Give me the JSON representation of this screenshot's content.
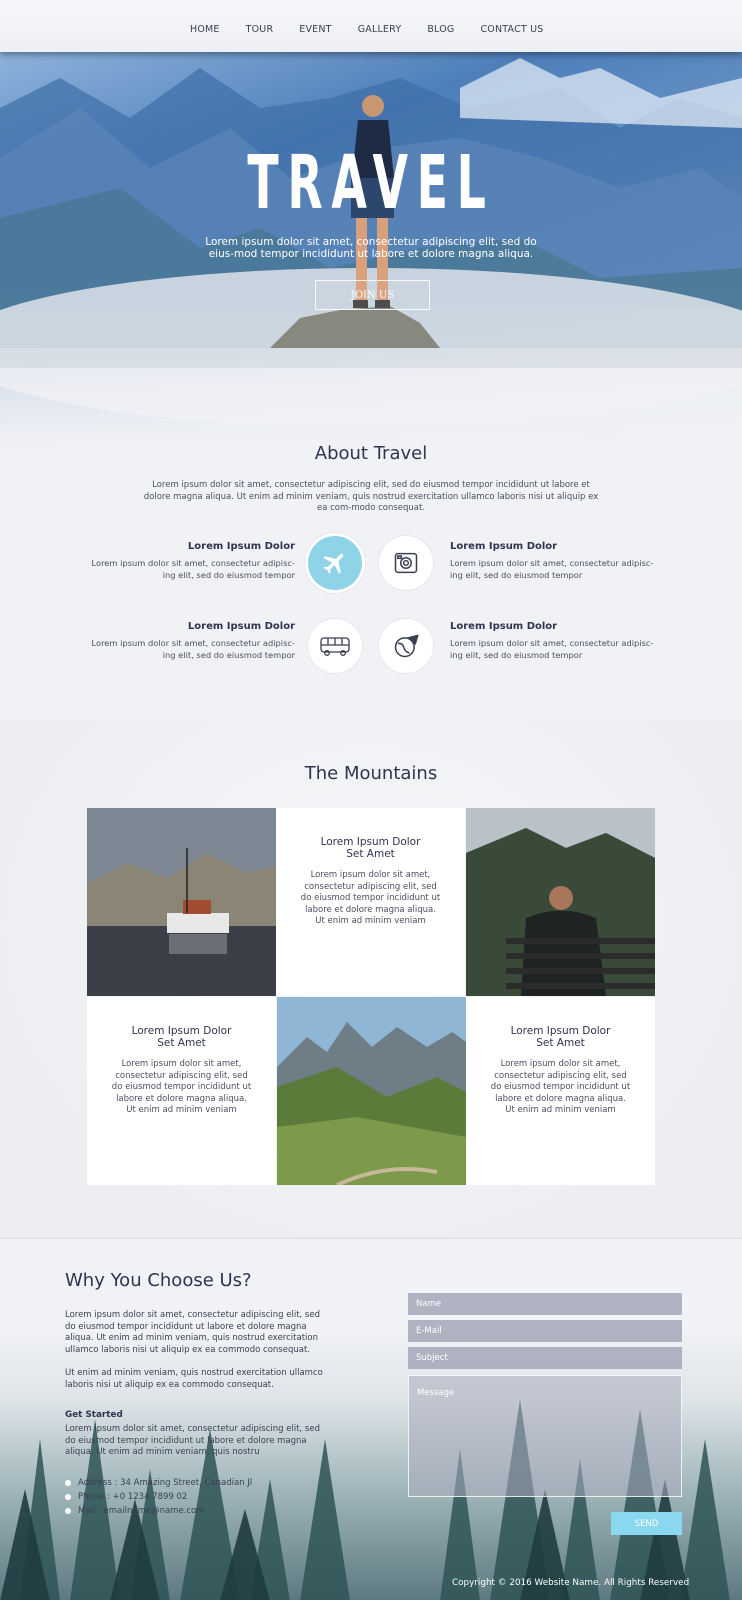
{
  "nav": {
    "items": [
      "HOME",
      "TOUR",
      "EVENT",
      "GALLERY",
      "BLOG",
      "CONTACT US"
    ]
  },
  "hero": {
    "title": "TRAVEL",
    "text": "Lorem ipsum dolor sit amet, consectetur adipiscing elit, sed do eius-mod tempor incididunt ut labore et dolore magna aliqua.",
    "button": "JOIN US"
  },
  "about": {
    "title": "About Travel",
    "text": "Lorem ipsum dolor sit amet, consectetur adipiscing elit, sed do eiusmod tempor incididunt ut labore et dolore magna aliqua. Ut enim ad minim veniam, quis nostrud exercitation ullamco laboris nisi ut aliquip ex ea com-modo consequat.",
    "features": [
      {
        "title": "Lorem Ipsum Dolor",
        "text": "Lorem ipsum dolor sit amet, consectetur adipisc-ing elit, sed do eiusmod tempor",
        "icon": "airplane-icon"
      },
      {
        "title": "Lorem Ipsum Dolor",
        "text": "Lorem ipsum dolor sit amet, consectetur adipisc-ing elit, sed do eiusmod tempor",
        "icon": "camera-icon"
      },
      {
        "title": "Lorem Ipsum Dolor",
        "text": "Lorem ipsum dolor sit amet, consectetur adipisc-ing elit, sed do eiusmod tempor",
        "icon": "bus-icon"
      },
      {
        "title": "Lorem Ipsum Dolor",
        "text": "Lorem ipsum dolor sit amet, consectetur adipisc-ing elit, sed do eiusmod tempor",
        "icon": "globe-plane-icon"
      }
    ]
  },
  "mountains": {
    "title": "The Mountains",
    "cards": [
      {
        "title": "Lorem Ipsum Dolor Set Amet",
        "text": "Lorem ipsum dolor sit amet, consectetur adipiscing elit, sed do eiusmod tempor incididunt ut labore et dolore magna aliqua. Ut enim ad minim veniam"
      },
      {
        "title": "Lorem Ipsum Dolor Set Amet",
        "text": "Lorem ipsum dolor sit amet, consectetur adipiscing elit, sed do eiusmod tempor incididunt ut labore et dolore magna aliqua. Ut enim ad minim veniam"
      },
      {
        "title": "Lorem Ipsum Dolor Set Amet",
        "text": "Lorem ipsum dolor sit amet, consectetur adipiscing elit, sed do eiusmod tempor incididunt ut labore et dolore magna aliqua. Ut enim ad minim veniam"
      }
    ]
  },
  "why": {
    "title": "Why You Choose Us?",
    "p1": "Lorem ipsum dolor sit amet, consectetur adipiscing elit, sed do eiusmod tempor incididunt ut labore et dolore magna aliqua. Ut enim ad minim veniam, quis nostrud exercitation ullamco laboris nisi ut aliquip ex ea commodo consequat.",
    "p2": "Ut enim ad minim veniam, quis nostrud exercitation ullamco laboris nisi ut aliquip ex ea commodo consequat.",
    "get_started": "Get Started",
    "p3": "Lorem ipsum dolor sit amet, consectetur adipiscing elit, sed do eiusmod tempor incididunt ut labore et dolore magna aliqua. Ut enim ad minim veniam, quis nostru",
    "address": "Address : 34 Amazing Street, Canadian Jl",
    "phone": "Phone : +0 1234 7899 02",
    "mail": "Mail : emailname@name.com"
  },
  "form": {
    "name_placeholder": "Name",
    "email_placeholder": "E-Mail",
    "subject_placeholder": "Subject",
    "message_placeholder": "Message",
    "send": "SEND"
  },
  "footer": {
    "copyright": "Copyright © 2016 Website Name. All Rights Reserved"
  },
  "colors": {
    "accent": "#8ad8ef",
    "heading": "#2f3450",
    "background": "#f1f2f5"
  }
}
